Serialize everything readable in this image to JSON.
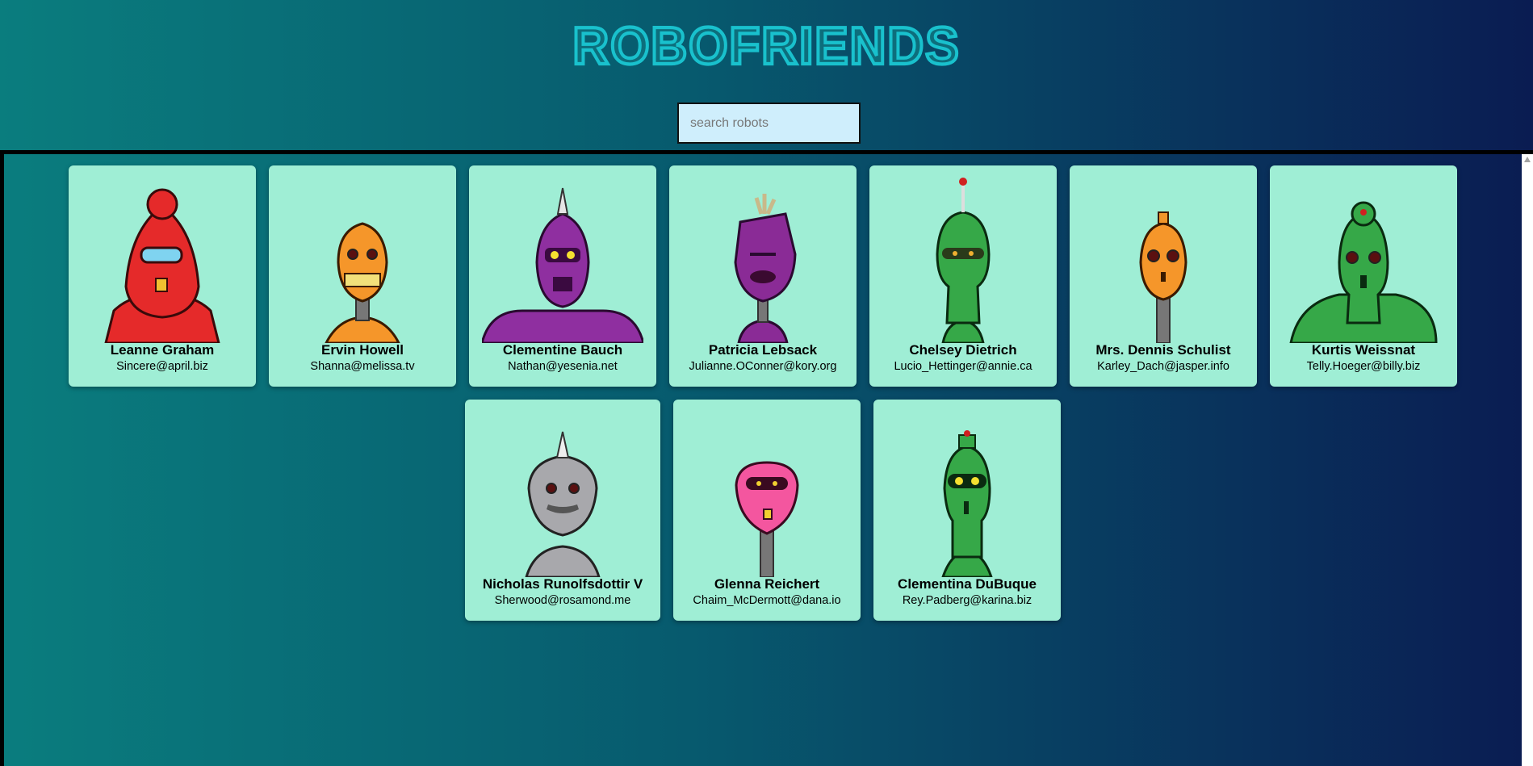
{
  "header": {
    "title": "ROBOFRIENDS"
  },
  "search": {
    "placeholder": "search robots",
    "value": ""
  },
  "robots": [
    {
      "name": "Leanne Graham",
      "email": "Sincere@april.biz",
      "color": "#e52a2a"
    },
    {
      "name": "Ervin Howell",
      "email": "Shanna@melissa.tv",
      "color": "#f5962a"
    },
    {
      "name": "Clementine Bauch",
      "email": "Nathan@yesenia.net",
      "color": "#8f2fa0"
    },
    {
      "name": "Patricia Lebsack",
      "email": "Julianne.OConner@kory.org",
      "color": "#8a2b96"
    },
    {
      "name": "Chelsey Dietrich",
      "email": "Lucio_Hettinger@annie.ca",
      "color": "#36a848"
    },
    {
      "name": "Mrs. Dennis Schulist",
      "email": "Karley_Dach@jasper.info",
      "color": "#f5962a"
    },
    {
      "name": "Kurtis Weissnat",
      "email": "Telly.Hoeger@billy.biz",
      "color": "#36a848"
    },
    {
      "name": "Nicholas Runolfsdottir V",
      "email": "Sherwood@rosamond.me",
      "color": "#a8a8ac"
    },
    {
      "name": "Glenna Reichert",
      "email": "Chaim_McDermott@dana.io",
      "color": "#f4569f"
    },
    {
      "name": "Clementina DuBuque",
      "email": "Rey.Padberg@karina.biz",
      "color": "#36a848"
    }
  ]
}
